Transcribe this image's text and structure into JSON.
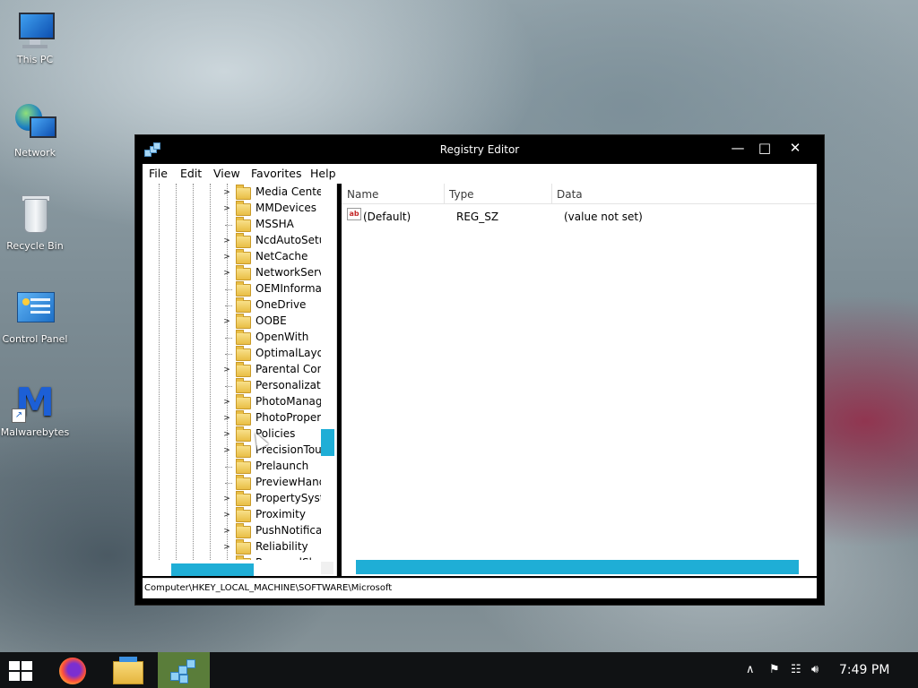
{
  "desktop": {
    "icons": [
      {
        "label": "This PC"
      },
      {
        "label": "Network"
      },
      {
        "label": "Recycle Bin"
      },
      {
        "label": "Control Panel"
      },
      {
        "label": "Malwarebytes"
      }
    ]
  },
  "window": {
    "title": "Registry Editor",
    "controls": {
      "minimize": "—",
      "maximize": "□",
      "close": "✕"
    },
    "menu": [
      "File",
      "Edit",
      "View",
      "Favorites",
      "Help"
    ],
    "tree": {
      "items": [
        {
          "label": "Media Center",
          "expander": ">"
        },
        {
          "label": "MMDevices",
          "expander": ">"
        },
        {
          "label": "MSSHA",
          "expander": ""
        },
        {
          "label": "NcdAutoSetup",
          "expander": ">"
        },
        {
          "label": "NetCache",
          "expander": ">"
        },
        {
          "label": "NetworkServic",
          "expander": ">"
        },
        {
          "label": "OEMInformatic",
          "expander": ""
        },
        {
          "label": "OneDrive",
          "expander": ""
        },
        {
          "label": "OOBE",
          "expander": ">"
        },
        {
          "label": "OpenWith",
          "expander": ""
        },
        {
          "label": "OptimalLayout",
          "expander": ""
        },
        {
          "label": "Parental Contr",
          "expander": ">"
        },
        {
          "label": "Personalization",
          "expander": ""
        },
        {
          "label": "PhotoManage",
          "expander": ">"
        },
        {
          "label": "PhotoProperty",
          "expander": ">"
        },
        {
          "label": "Policies",
          "expander": ">"
        },
        {
          "label": "PrecisionTouch",
          "expander": ">"
        },
        {
          "label": "Prelaunch",
          "expander": ""
        },
        {
          "label": "PreviewHandle",
          "expander": ""
        },
        {
          "label": "PropertySyster",
          "expander": ">"
        },
        {
          "label": "Proximity",
          "expander": ">"
        },
        {
          "label": "PushNotificatic",
          "expander": ">"
        },
        {
          "label": "Reliability",
          "expander": ">"
        },
        {
          "label": "RemovalSh",
          "expander": ">"
        }
      ]
    },
    "list": {
      "columns": [
        "Name",
        "Type",
        "Data"
      ],
      "rows": [
        {
          "icon": "ab",
          "name": "(Default)",
          "type": "REG_SZ",
          "data": "(value not set)"
        }
      ]
    },
    "status": "Computer\\HKEY_LOCAL_MACHINE\\SOFTWARE\\Microsoft"
  },
  "taskbar": {
    "apps": [
      "start-button",
      "firefox",
      "file-explorer",
      "registry-editor"
    ],
    "active_app": "registry-editor",
    "active_color": "#5a7d3a",
    "clock": "7:49 PM"
  },
  "colors": {
    "scroll_accent": "#1faed6"
  }
}
